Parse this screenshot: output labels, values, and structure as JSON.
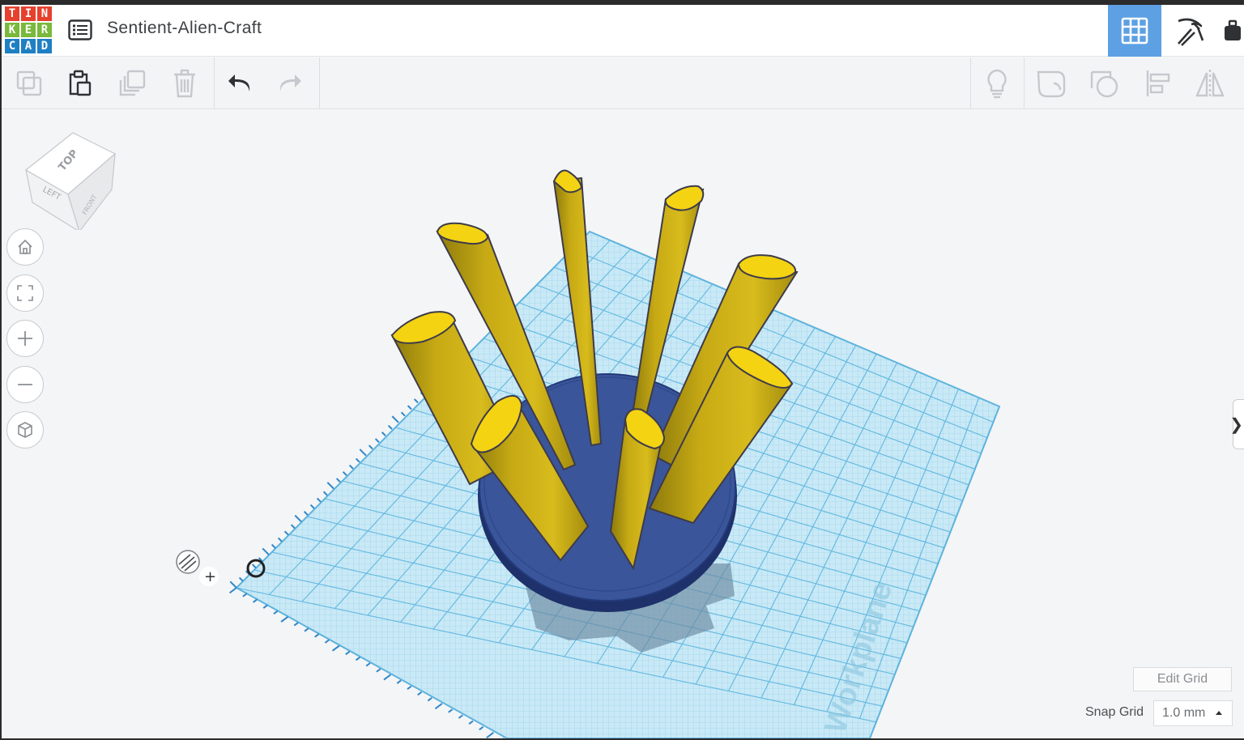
{
  "app": {
    "logo_letters": [
      "T",
      "I",
      "N",
      "K",
      "E",
      "R",
      "C",
      "A",
      "D"
    ],
    "design_title": "Sentient-Alien-Craft"
  },
  "header": {
    "icons": [
      "list-icon",
      "grid-view-icon",
      "pickaxe-icon",
      "briefcase-icon"
    ],
    "accent_color": "#5da0e3"
  },
  "toolbar": {
    "icons": [
      "copy-icon",
      "paste-icon",
      "duplicate-icon",
      "delete-icon",
      "undo-icon",
      "redo-icon",
      "lightbulb-icon",
      "group-icon",
      "ungroup-icon",
      "align-icon",
      "mirror-icon"
    ]
  },
  "viewcube": {
    "top_label": "TOP",
    "left_label": "LEFT",
    "front_label": "FRONT"
  },
  "nav": {
    "icons": [
      "home-icon",
      "fit-view-icon",
      "zoom-in-icon",
      "zoom-out-icon",
      "perspective-icon"
    ]
  },
  "footer": {
    "edit_grid_label": "Edit Grid",
    "snap_grid_label": "Snap Grid",
    "snap_grid_value": "1.0 mm"
  },
  "workplane": {
    "watermark": "Workplane",
    "shape_colors": {
      "base": "#3a559a",
      "cylinders": "#c8ab14",
      "tops": "#f4d312",
      "grid": "#9fd6ee"
    }
  }
}
